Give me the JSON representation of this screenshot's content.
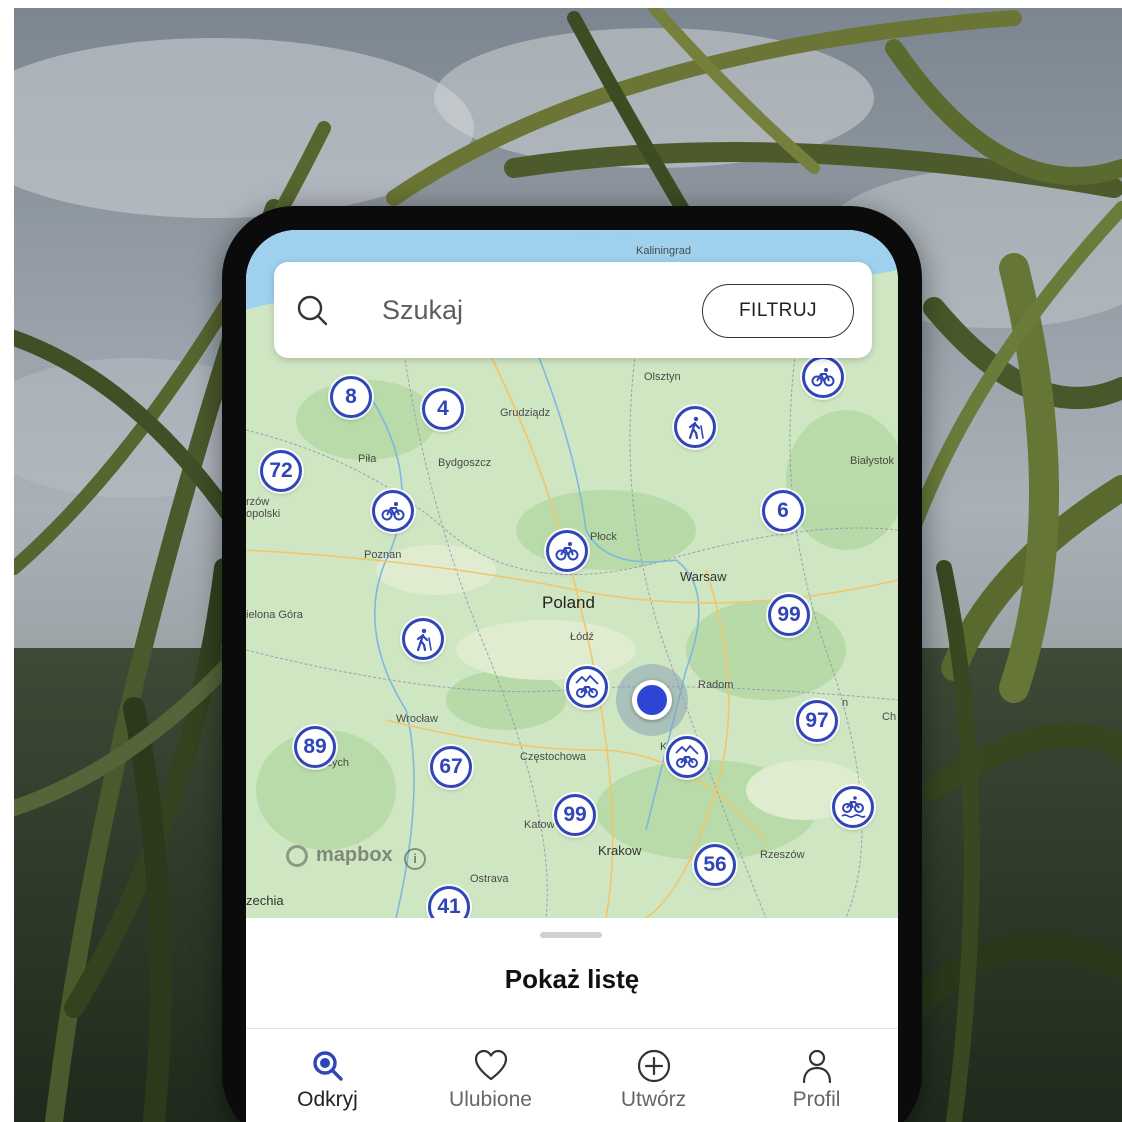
{
  "search": {
    "placeholder": "Szukaj",
    "filter_label": "FILTRUJ"
  },
  "map": {
    "places": {
      "kaliningrad": "Kaliningrad",
      "olsztyn": "Olsztyn",
      "grudziadz": "Grudziądz",
      "bydgoszcz": "Bydgoszcz",
      "pila": "Piła",
      "bialystok": "Białystok",
      "gorzow": "rzów\nopolski",
      "poznan": "Poznan",
      "plock": "Płock",
      "warsaw": "Warsaw",
      "poland": "Poland",
      "zielona_gora": "ielona Góra",
      "lodz": "Łódź",
      "radom": "Radom",
      "wroclaw": "Wrocław",
      "walbrzych": "ałbrzych",
      "czestochowa": "Częstochowa",
      "katowice": "Katow",
      "krakow": "Krakow",
      "rzeszow": "Rzeszów",
      "ostrava": "Ostrava",
      "czechia": "zechia",
      "lublin_fragment": "n",
      "chelm_fragment": "Ch",
      "kielce_fragment": "K"
    },
    "clusters": [
      {
        "id": "c8",
        "count": "8"
      },
      {
        "id": "c4",
        "count": "4"
      },
      {
        "id": "c72",
        "count": "72"
      },
      {
        "id": "c6",
        "count": "6"
      },
      {
        "id": "c99a",
        "count": "99"
      },
      {
        "id": "c97",
        "count": "97"
      },
      {
        "id": "c89",
        "count": "89"
      },
      {
        "id": "c67",
        "count": "67"
      },
      {
        "id": "c99b",
        "count": "99"
      },
      {
        "id": "c56",
        "count": "56"
      },
      {
        "id": "c41",
        "count": "41"
      }
    ],
    "activity_markers": [
      {
        "id": "a1",
        "type": "bike"
      },
      {
        "id": "a2",
        "type": "hike"
      },
      {
        "id": "a3",
        "type": "bike"
      },
      {
        "id": "a4",
        "type": "bike"
      },
      {
        "id": "a5",
        "type": "hike"
      },
      {
        "id": "a6",
        "type": "mountain-bike"
      },
      {
        "id": "a7",
        "type": "mountain-bike"
      },
      {
        "id": "a8",
        "type": "bike-water"
      }
    ],
    "attribution": "mapbox",
    "info_symbol": "i"
  },
  "sheet": {
    "show_list_label": "Pokaż listę"
  },
  "tabs": [
    {
      "id": "discover",
      "label": "Odkryj",
      "icon": "search-icon",
      "active": true
    },
    {
      "id": "favorites",
      "label": "Ulubione",
      "icon": "heart-icon",
      "active": false
    },
    {
      "id": "create",
      "label": "Utwórz",
      "icon": "plus-circle-icon",
      "active": false
    },
    {
      "id": "profile",
      "label": "Profil",
      "icon": "person-icon",
      "active": false
    }
  ],
  "colors": {
    "accent": "#2f45b8",
    "location_dot": "#2f45d6",
    "map_land": "#cfe6c3",
    "map_water": "#9fd0ee"
  }
}
